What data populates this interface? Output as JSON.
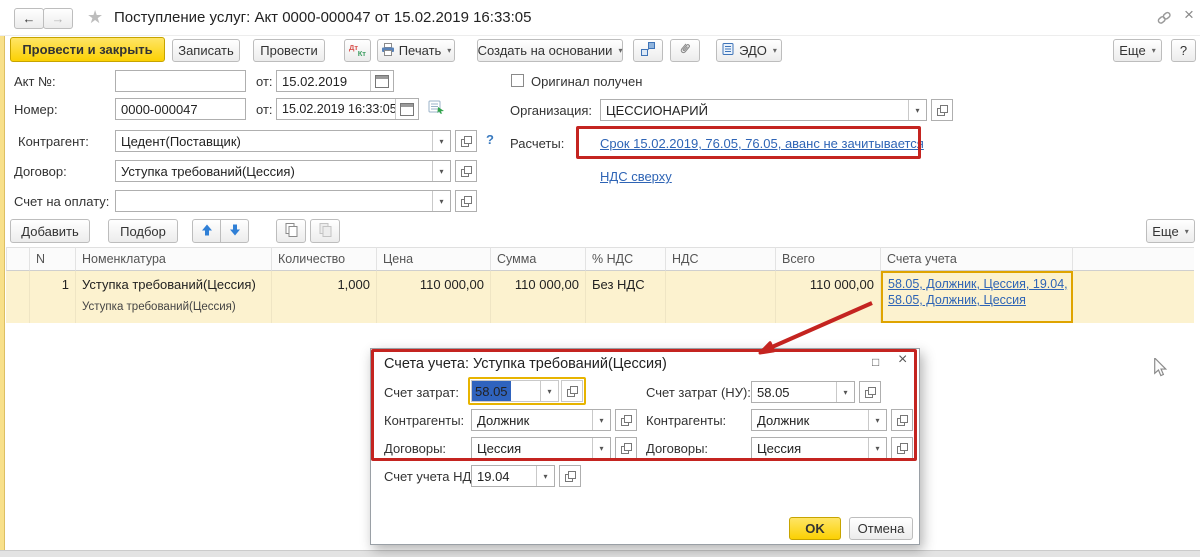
{
  "header": {
    "title": "Поступление услуг: Акт 0000-000047 от 15.02.2019 16:33:05"
  },
  "icons": {
    "back": "←",
    "forward": "→",
    "star": "★",
    "close": "×",
    "maximize": "□",
    "dropdown": "▾",
    "help": "?",
    "dtkt_top": "Дт",
    "dtkt_bottom": "Кт",
    "question_hint": "?"
  },
  "toolbar": {
    "post_and_close": "Провести и закрыть",
    "save": "Записать",
    "post": "Провести",
    "print": "Печать",
    "create_based_on": "Создать на основании",
    "edo": "ЭДО",
    "more": "Еще",
    "help": "?"
  },
  "form": {
    "act_no_label": "Акт №:",
    "act_no_value": "",
    "act_from_label": "от:",
    "act_date": "15.02.2019",
    "number_label": "Номер:",
    "number_value": "0000-000047",
    "number_from_label": "от:",
    "number_datetime": "15.02.2019 16:33:05",
    "counterparty_label": "Контрагент:",
    "counterparty_value": "Цедент(Поставщик)",
    "contract_label": "Договор:",
    "contract_value": "Уступка требований(Цессия)",
    "invoice_label": "Счет на оплату:",
    "invoice_value": "",
    "original_received_label": "Оригинал получен",
    "organization_label": "Организация:",
    "organization_value": "ЦЕССИОНАРИЙ",
    "settlements_label": "Расчеты:",
    "settlements_link": "Срок 15.02.2019, 76.05, 76.05, аванс не зачитывается",
    "vat_link": "НДС сверху"
  },
  "table_toolbar": {
    "add": "Добавить",
    "pick": "Подбор",
    "more": "Еще"
  },
  "table": {
    "headers": [
      "N",
      "Номенклатура",
      "Количество",
      "Цена",
      "Сумма",
      "% НДС",
      "НДС",
      "Всего",
      "Счета учета"
    ],
    "rows": [
      {
        "n": "1",
        "nomenclature": "Уступка требований(Цессия)",
        "nomenclature2": "Уступка требований(Цессия)",
        "qty": "1,000",
        "price": "110 000,00",
        "sum": "110 000,00",
        "vat_pct": "Без НДС",
        "vat": "",
        "total": "110 000,00",
        "accounts_line1": "58.05, Должник, Цессия, 19.04,",
        "accounts_line2": "58.05, Должник, Цессия"
      }
    ]
  },
  "dialog": {
    "title": "Счета учета: Уступка требований(Цессия)",
    "cost_account_label": "Счет затрат:",
    "cost_account_value": "58.05",
    "cost_account_nu_label": "Счет затрат (НУ):",
    "cost_account_nu_value": "58.05",
    "counterparties_label": "Контрагенты:",
    "counterparties_value": "Должник",
    "counterparties_nu_label": "Контрагенты:",
    "counterparties_nu_value": "Должник",
    "contracts_label": "Договоры:",
    "contracts_value": "Цессия",
    "contracts_nu_label": "Договоры:",
    "contracts_nu_value": "Цессия",
    "vat_account_label": "Счет учета НДС:",
    "vat_account_value": "19.04",
    "ok": "OK",
    "cancel": "Отмена"
  },
  "colors": {
    "accent_yellow": "#fbd103",
    "annotation_red": "#c42420",
    "link_blue": "#2e64b5",
    "row_highlight": "#fcf2cf",
    "focus_orange": "#e7b400",
    "selection_blue": "#2f63be"
  }
}
